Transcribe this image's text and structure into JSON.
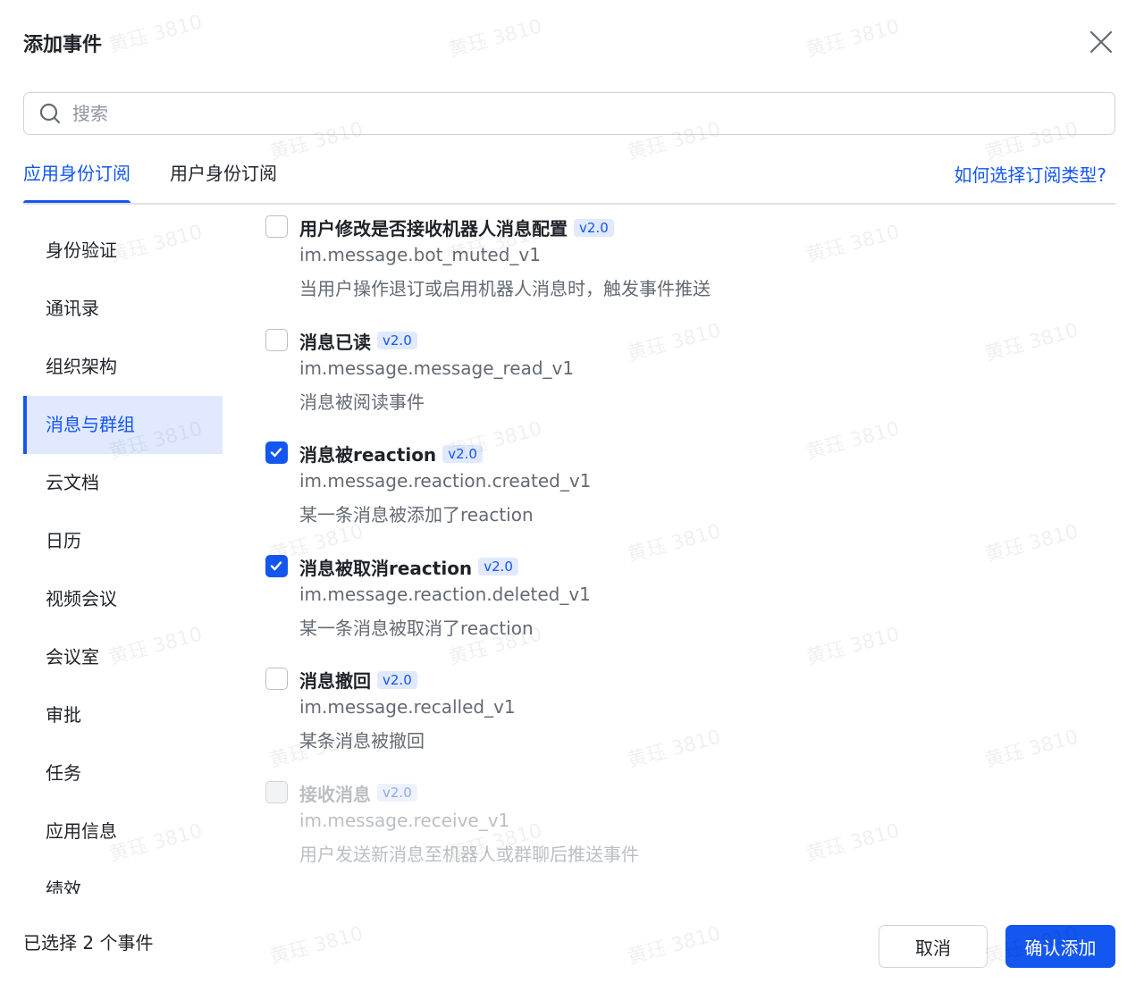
{
  "dialog": {
    "title": "添加事件"
  },
  "search": {
    "placeholder": "搜索",
    "value": ""
  },
  "tabs": [
    {
      "label": "应用身份订阅",
      "active": true
    },
    {
      "label": "用户身份订阅",
      "active": false
    }
  ],
  "help_link": "如何选择订阅类型?",
  "sidebar": {
    "items": [
      {
        "label": "身份验证"
      },
      {
        "label": "通讯录"
      },
      {
        "label": "组织架构"
      },
      {
        "label": "消息与群组",
        "active": true
      },
      {
        "label": "云文档"
      },
      {
        "label": "日历"
      },
      {
        "label": "视频会议"
      },
      {
        "label": "会议室"
      },
      {
        "label": "审批"
      },
      {
        "label": "任务"
      },
      {
        "label": "应用信息"
      },
      {
        "label": "绩效"
      }
    ]
  },
  "events": [
    {
      "title": "用户修改是否接收机器人消息配置",
      "version": "v2.0",
      "code": "im.message.bot_muted_v1",
      "desc": "当用户操作退订或启用机器人消息时，触发事件推送",
      "checked": false,
      "disabled": false
    },
    {
      "title": "消息已读",
      "version": "v2.0",
      "code": "im.message.message_read_v1",
      "desc": "消息被阅读事件",
      "checked": false,
      "disabled": false
    },
    {
      "title": "消息被reaction",
      "version": "v2.0",
      "code": "im.message.reaction.created_v1",
      "desc": "某一条消息被添加了reaction",
      "checked": true,
      "disabled": false
    },
    {
      "title": "消息被取消reaction",
      "version": "v2.0",
      "code": "im.message.reaction.deleted_v1",
      "desc": "某一条消息被取消了reaction",
      "checked": true,
      "disabled": false
    },
    {
      "title": "消息撤回",
      "version": "v2.0",
      "code": "im.message.recalled_v1",
      "desc": "某条消息被撤回",
      "checked": false,
      "disabled": false
    },
    {
      "title": "接收消息",
      "version": "v2.0",
      "code": "im.message.receive_v1",
      "desc": "用户发送新消息至机器人或群聊后推送事件",
      "checked": false,
      "disabled": true
    }
  ],
  "footer": {
    "selected_text": "已选择 2 个事件",
    "cancel_label": "取消",
    "confirm_label": "确认添加"
  },
  "watermark": "黄珏 3810",
  "colors": {
    "accent": "#1456f0",
    "active_bg": "#e0e9ff"
  }
}
